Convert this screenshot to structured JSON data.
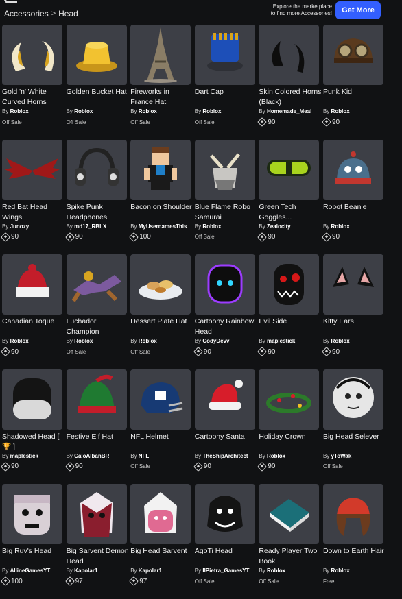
{
  "header": {
    "breadcrumb": [
      "Accessories",
      "Head"
    ],
    "breadcrumb_sep": ">",
    "explore_text_1": "Explore the marketplace",
    "explore_text_2": "to find more Accessories!",
    "get_more_label": "Get More"
  },
  "colors": {
    "accent": "#335fff",
    "card_bg": "#3d3f46",
    "page_bg": "#111214"
  },
  "items": [
    {
      "name": "Gold 'n' White Curved Horns",
      "by": "By",
      "creator": "Roblox",
      "price": "Off Sale",
      "icon": "horns-icon"
    },
    {
      "name": "Golden Bucket Hat",
      "by": "By",
      "creator": "Roblox",
      "price": "Off Sale",
      "icon": "bucket-hat-icon"
    },
    {
      "name": "Fireworks in France Hat",
      "by": "By",
      "creator": "Roblox",
      "price": "Off Sale",
      "icon": "eiffel-tower-icon"
    },
    {
      "name": "Dart Cap",
      "by": "By",
      "creator": "Roblox",
      "price": "Off Sale",
      "icon": "cap-icon"
    },
    {
      "name": "Skin Colored Horns (Black)",
      "by": "By",
      "creator": "Homemade_Meal",
      "price": "90",
      "icon": "black-horns-icon"
    },
    {
      "name": "Punk Kid",
      "by": "By",
      "creator": "Roblox",
      "price": "90",
      "icon": "aviator-cap-icon"
    },
    {
      "name": "Red Bat Head Wings",
      "by": "By",
      "creator": "Junozy",
      "price": "90",
      "icon": "bat-wings-icon"
    },
    {
      "name": "Spike Punk Headphones",
      "by": "By",
      "creator": "md17_RBLX",
      "price": "90",
      "icon": "headphones-icon"
    },
    {
      "name": "Bacon on Shoulder",
      "by": "By",
      "creator": "MyUsernamesThis",
      "price": "100",
      "icon": "bacon-avatar-icon"
    },
    {
      "name": "Blue Flame Robo Samurai",
      "by": "By",
      "creator": "Roblox",
      "price": "Off Sale",
      "icon": "samurai-helmet-icon"
    },
    {
      "name": "Green Tech Goggles...",
      "by": "By",
      "creator": "Zealocity",
      "price": "90",
      "icon": "goggles-icon"
    },
    {
      "name": "Robot Beanie",
      "by": "By",
      "creator": "Roblox",
      "price": "90",
      "icon": "robot-beanie-icon"
    },
    {
      "name": "Canadian Toque",
      "by": "By",
      "creator": "Roblox",
      "price": "90",
      "icon": "toque-icon"
    },
    {
      "name": "Luchador Champion",
      "by": "By",
      "creator": "Roblox",
      "price": "Off Sale",
      "icon": "luchador-icon"
    },
    {
      "name": "Dessert Plate Hat",
      "by": "By",
      "creator": "Roblox",
      "price": "Off Sale",
      "icon": "dessert-plate-icon"
    },
    {
      "name": "Cartoony Rainbow Head",
      "by": "By",
      "creator": "CodyDevv",
      "price": "90",
      "icon": "rainbow-head-icon"
    },
    {
      "name": "Evil Side",
      "by": "By",
      "creator": "maplestick",
      "price": "90",
      "icon": "evil-mask-icon"
    },
    {
      "name": "Kitty Ears",
      "by": "By",
      "creator": "Roblox",
      "price": "90",
      "icon": "cat-ears-icon"
    },
    {
      "name": "Shadowed Head [ 🏆 ]",
      "by": "By",
      "creator": "maplestick",
      "price": "90",
      "icon": "shadow-head-icon"
    },
    {
      "name": "Festive Elf Hat",
      "by": "By",
      "creator": "CaloAlbanBR",
      "price": "90",
      "icon": "elf-hat-icon"
    },
    {
      "name": "NFL Helmet",
      "by": "By",
      "creator": "NFL",
      "price": "Off Sale",
      "icon": "football-helmet-icon"
    },
    {
      "name": "Cartoony Santa",
      "by": "By",
      "creator": "TheShipArchitect",
      "price": "90",
      "icon": "santa-hat-icon"
    },
    {
      "name": "Holiday Crown",
      "by": "By",
      "creator": "Roblox",
      "price": "90",
      "icon": "holly-crown-icon"
    },
    {
      "name": "Big Head Selever",
      "by": "By",
      "creator": "yToWak",
      "price": "Off Sale",
      "icon": "big-head-icon"
    },
    {
      "name": "Big Ruv's Head",
      "by": "By",
      "creator": "AllineGamesYT",
      "price": "100",
      "icon": "ruv-head-icon"
    },
    {
      "name": "Big Sarvent Demon Head",
      "by": "By",
      "creator": "Kapolar1",
      "price": "97",
      "icon": "demon-head-icon"
    },
    {
      "name": "Big Head Sarvent",
      "by": "By",
      "creator": "Kapolar1",
      "price": "97",
      "icon": "sarvent-head-icon"
    },
    {
      "name": "AgoTi Head",
      "by": "By",
      "creator": "IIPietra_GamesYT",
      "price": "Off Sale",
      "icon": "agoti-head-icon"
    },
    {
      "name": "Ready Player Two Book",
      "by": "By",
      "creator": "Roblox",
      "price": "Off Sale",
      "icon": "book-icon"
    },
    {
      "name": "Down to Earth Hair",
      "by": "By",
      "creator": "Roblox",
      "price": "Free",
      "icon": "hair-beanie-icon"
    }
  ]
}
